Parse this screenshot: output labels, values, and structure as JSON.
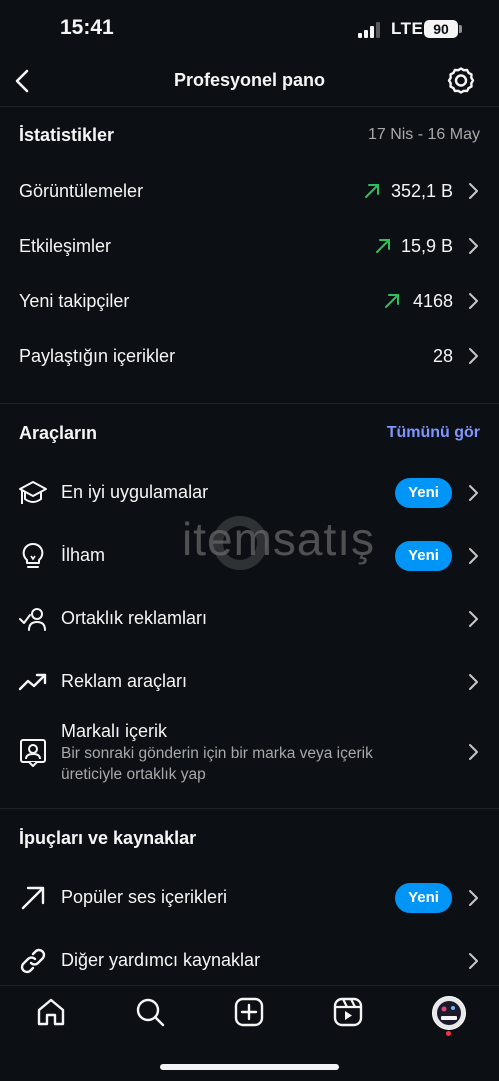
{
  "status_bar": {
    "time": "15:41",
    "network": "LTE",
    "battery": "90"
  },
  "header": {
    "title": "Profesyonel pano",
    "back_icon": "chevron-left-icon",
    "settings_icon": "gear-icon"
  },
  "statistics": {
    "title": "İstatistikler",
    "date_range": "17 Nis - 16 May",
    "rows": [
      {
        "label": "Görüntülemeler",
        "value": "352,1 B",
        "trend": "up"
      },
      {
        "label": "Etkileşimler",
        "value": "15,9 B",
        "trend": "up"
      },
      {
        "label": "Yeni takipçiler",
        "value": "4168",
        "trend": "up"
      },
      {
        "label": "Paylaştığın içerikler",
        "value": "28",
        "trend": "none"
      }
    ],
    "trend_color": "#2ec05a"
  },
  "tools": {
    "title": "Araçların",
    "see_all": "Tümünü gör",
    "items": [
      {
        "label": "En iyi uygulamalar",
        "badge": "Yeni",
        "icon": "graduation-cap-icon"
      },
      {
        "label": "İlham",
        "badge": "Yeni",
        "icon": "lightbulb-icon"
      },
      {
        "label": "Ortaklık reklamları",
        "icon": "partnership-icon"
      },
      {
        "label": "Reklam araçları",
        "icon": "trending-up-icon"
      },
      {
        "label": "Markalı içerik",
        "description": "Bir sonraki gönderin için bir marka veya içerik üreticiyle ortaklık yap",
        "icon": "branded-content-icon"
      }
    ]
  },
  "resources": {
    "title": "İpuçları ve kaynaklar",
    "items": [
      {
        "label": "Popüler ses içerikleri",
        "badge": "Yeni",
        "icon": "arrow-up-right-icon"
      },
      {
        "label": "Diğer yardımcı kaynaklar",
        "icon": "link-icon"
      }
    ]
  },
  "watermark": {
    "text": "itemsatış"
  },
  "bottom_nav": [
    "home-icon",
    "search-icon",
    "create-icon",
    "reels-icon",
    "profile-avatar"
  ],
  "colors": {
    "background": "#0c1014",
    "accent_blue": "#0095f6",
    "link_blue": "#7f95ff",
    "notification": "#ff3040"
  }
}
